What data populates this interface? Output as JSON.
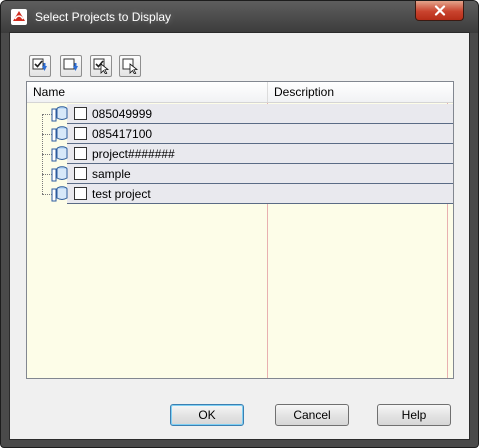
{
  "window": {
    "title": "Select Projects to Display",
    "icons": {
      "app": "app-logo-icon",
      "close": "close-icon"
    },
    "colors": {
      "titlebar": "#4a4a4a",
      "close": "#c9432e",
      "list_bg": "#fdfde8"
    }
  },
  "toolbar": {
    "buttons": [
      {
        "icon": "check-all-icon"
      },
      {
        "icon": "uncheck-all-icon"
      },
      {
        "icon": "check-selected-icon"
      },
      {
        "icon": "uncheck-selected-icon"
      }
    ]
  },
  "tree": {
    "columns": [
      "Name",
      "Description"
    ],
    "rows": [
      {
        "name": "085049999",
        "description": "",
        "checked": false,
        "icon": "project-database-icon"
      },
      {
        "name": "085417100",
        "description": "",
        "checked": false,
        "icon": "project-database-icon"
      },
      {
        "name": "project#######",
        "description": "",
        "checked": false,
        "icon": "project-database-icon"
      },
      {
        "name": "sample",
        "description": "",
        "checked": false,
        "icon": "project-database-icon"
      },
      {
        "name": "test project",
        "description": "",
        "checked": false,
        "icon": "project-database-icon"
      }
    ]
  },
  "buttons": {
    "ok": "OK",
    "cancel": "Cancel",
    "help": "Help"
  }
}
